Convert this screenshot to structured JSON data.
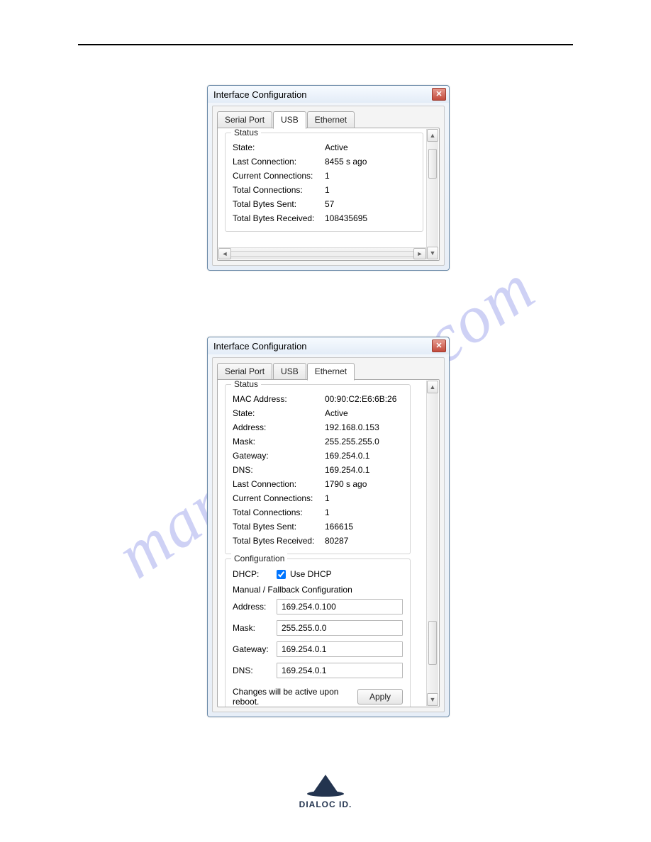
{
  "watermark": "manualshive.com",
  "logo_text": "DIALOC ID.",
  "dialog1": {
    "title": "Interface Configuration",
    "tabs": {
      "serial": "Serial Port",
      "usb": "USB",
      "eth": "Ethernet"
    },
    "group_status": "Status",
    "status": {
      "state_label": "State:",
      "state_value": "Active",
      "lastconn_label": "Last Connection:",
      "lastconn_value": "8455 s ago",
      "curconn_label": "Current Connections:",
      "curconn_value": "1",
      "totconn_label": "Total Connections:",
      "totconn_value": "1",
      "sent_label": "Total Bytes Sent:",
      "sent_value": "57",
      "recv_label": "Total Bytes Received:",
      "recv_value": "108435695"
    }
  },
  "dialog2": {
    "title": "Interface Configuration",
    "tabs": {
      "serial": "Serial Port",
      "usb": "USB",
      "eth": "Ethernet"
    },
    "group_status": "Status",
    "status": {
      "mac_label": "MAC Address:",
      "mac_value": "00:90:C2:E6:6B:26",
      "state_label": "State:",
      "state_value": "Active",
      "addr_label": "Address:",
      "addr_value": "192.168.0.153",
      "mask_label": "Mask:",
      "mask_value": "255.255.255.0",
      "gw_label": "Gateway:",
      "gw_value": "169.254.0.1",
      "dns_label": "DNS:",
      "dns_value": "169.254.0.1",
      "lastconn_label": "Last Connection:",
      "lastconn_value": "1790 s ago",
      "curconn_label": "Current Connections:",
      "curconn_value": "1",
      "totconn_label": "Total Connections:",
      "totconn_value": "1",
      "sent_label": "Total Bytes Sent:",
      "sent_value": "166615",
      "recv_label": "Total Bytes Received:",
      "recv_value": "80287"
    },
    "group_config": "Configuration",
    "dhcp_label": "DHCP:",
    "dhcp_check_label": "Use DHCP",
    "dhcp_checked": true,
    "fallback_header": "Manual / Fallback Configuration",
    "fields": {
      "addr_label": "Address:",
      "addr_value": "169.254.0.100",
      "mask_label": "Mask:",
      "mask_value": "255.255.0.0",
      "gw_label": "Gateway:",
      "gw_value": "169.254.0.1",
      "dns_label": "DNS:",
      "dns_value": "169.254.0.1"
    },
    "apply_note": "Changes will be active upon reboot.",
    "apply_button": "Apply"
  }
}
